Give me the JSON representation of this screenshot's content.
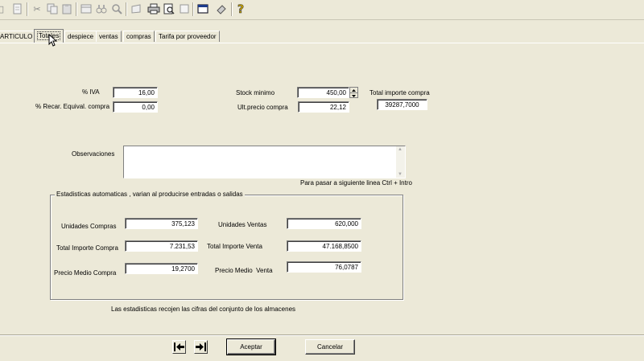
{
  "toolbar": {
    "icons": [
      "cut-icon",
      "copy-icon",
      "paste-icon",
      "print-preview-icon",
      "binoculars-icon",
      "search-icon",
      "note-icon",
      "print-icon",
      "report-preview-icon",
      "page-icon",
      "window-icon",
      "eraser-icon",
      "help-icon"
    ]
  },
  "tabs": [
    {
      "label": "ARTICULO"
    },
    {
      "label": "Totales"
    },
    {
      "label": "despiece"
    },
    {
      "label": "ventas"
    },
    {
      "label": "compras"
    },
    {
      "label": "Tarifa por proveedor"
    }
  ],
  "fields": {
    "iva": {
      "label": "% IVA",
      "value": "16,00"
    },
    "recargo": {
      "label": "% Recar. Equival. compra",
      "value": "0,00"
    },
    "stock_minimo": {
      "label": "Stock minimo",
      "value": "450,00"
    },
    "ult_precio": {
      "label": "Ult.precio compra",
      "value": "22,12"
    },
    "total_importe": {
      "label": "Total importe compra",
      "value": "39287,7000"
    }
  },
  "observaciones": {
    "label": "Observaciones",
    "value": "",
    "hint": "Para pasar a siguiente linea Ctrl + Intro"
  },
  "stats": {
    "title": "Estadisticas automaticas , varian al producirse entradas o salidas",
    "unidades_compras": {
      "label": "Unidades Compras",
      "value": "375,123"
    },
    "unidades_ventas": {
      "label": "Unidades Ventas",
      "value": "620,000"
    },
    "total_importe_compra": {
      "label": "Total Importe Compra",
      "value": "7.231,53"
    },
    "total_importe_venta": {
      "label": "Total Importe Venta",
      "value": "47.168,8500"
    },
    "precio_medio_compra": {
      "label": "Precio Medio Compra",
      "value": "19,2700"
    },
    "precio_medio_venta": {
      "label": "Precio Medio  Venta",
      "value": "76,0787"
    },
    "footnote": "Las estadisticas recojen las cifras del conjunto de los almacenes"
  },
  "buttons": {
    "accept": "Aceptar",
    "cancel": "Cancelar"
  }
}
